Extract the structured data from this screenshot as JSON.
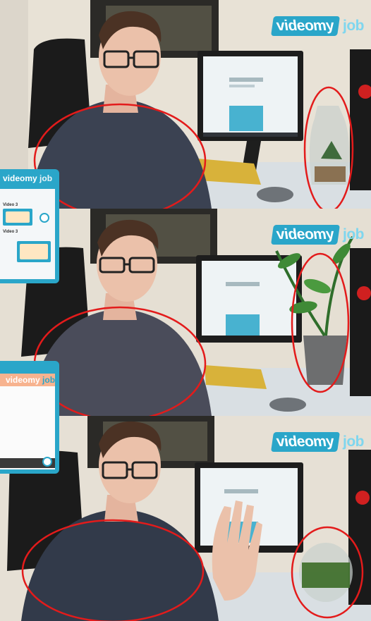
{
  "logo": {
    "video": "video",
    "my": "my",
    "job": "job"
  },
  "thumbnail_1": {
    "label_a": "Video 3",
    "label_b": "Video 3"
  },
  "thumbnail_2": {
    "brand": "videomy",
    "job": "job"
  },
  "frames": [
    {
      "id": "frame-1",
      "object": "glass terrarium jar"
    },
    {
      "id": "frame-2",
      "object": "potted plant"
    },
    {
      "id": "frame-3",
      "object": "round glass terrarium"
    }
  ],
  "colors": {
    "brand_blue": "#2aa6c9",
    "annotation_red": "#e31b1b",
    "wall": "#e8e2d6",
    "shirt": "#3b4252"
  }
}
